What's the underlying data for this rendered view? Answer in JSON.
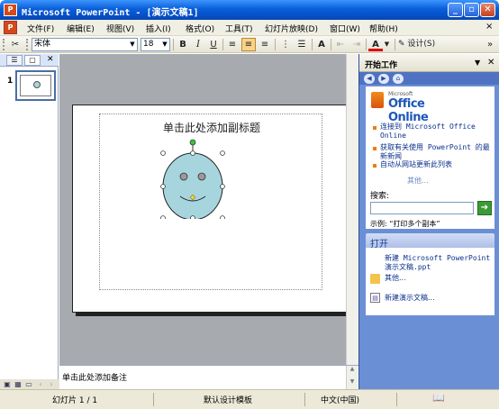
{
  "window": {
    "title": "Microsoft PowerPoint - [演示文稿1]",
    "minimize_glyph": "_",
    "restore_glyph": "▫",
    "close_glyph": "✕"
  },
  "menu": {
    "items": [
      "文件(F)",
      "编辑(E)",
      "视图(V)",
      "插入(I)",
      "格式(O)",
      "工具(T)",
      "幻灯片放映(D)",
      "窗口(W)",
      "帮助(H)"
    ],
    "close_glyph": "×"
  },
  "toolbar": {
    "cut_glyph": "✂",
    "font_name": "宋体",
    "font_size": "18",
    "bold": "B",
    "italic": "I",
    "underline": "U",
    "grow_font": "A",
    "font_color": "A",
    "design_label": "设计(S)"
  },
  "slide_pane": {
    "slide_number": "1"
  },
  "slide": {
    "subtitle_placeholder": "单击此处添加副标题"
  },
  "notes": {
    "placeholder": "单击此处添加备注"
  },
  "task_pane": {
    "title": "开始工作",
    "logo_small": "Microsoft",
    "logo_text": "Office Online",
    "links": [
      "连接到 Microsoft Office Online",
      "获取有关使用 PowerPoint 的最新新闻",
      "自动从网站更新此列表"
    ],
    "more": "其他...",
    "search_label": "搜索:",
    "search_value": "",
    "example": "示例: “打印多个副本”",
    "open_section": "打开",
    "files": [
      "新建 Microsoft PowerPoint 演示文稿.ppt"
    ],
    "open_more": "其他...",
    "new_presentation": "新建演示文稿..."
  },
  "status": {
    "slide": "幻灯片 1 / 1",
    "design": "默认设计模板",
    "language": "中文(中国)"
  },
  "colors": {
    "titlebar": "#0a5fd8",
    "taskpane": "#6b8fd4",
    "workspace": "#a7abb0",
    "face": "#a7d5de"
  }
}
